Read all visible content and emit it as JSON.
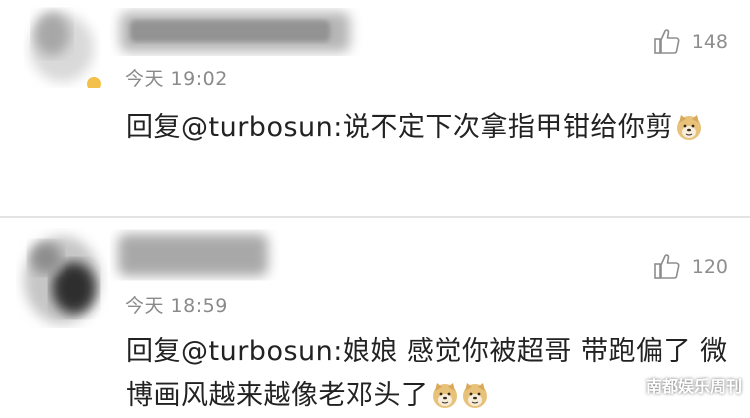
{
  "comments": [
    {
      "time": "今天 19:02",
      "likes": "148",
      "reply_prefix": "回复",
      "mention": "@turbosun",
      "text": ":说不定下次拿指甲钳给你剪",
      "emoji": "doge-emoji",
      "emoji_count": 1
    },
    {
      "time": "今天 18:59",
      "likes": "120",
      "reply_prefix": "回复",
      "mention": "@turbosun",
      "text": ":娘娘 感觉你被超哥 带跑偏了 微博画风越来越像老邓头了",
      "emoji": "doge-emoji",
      "emoji_count": 2
    }
  ],
  "watermark": {
    "text": "南都娱乐周刊",
    "icon": "wechat-icon"
  },
  "colors": {
    "text": "#222222",
    "meta": "#8a8a8a",
    "divider": "#e3e3e3"
  }
}
